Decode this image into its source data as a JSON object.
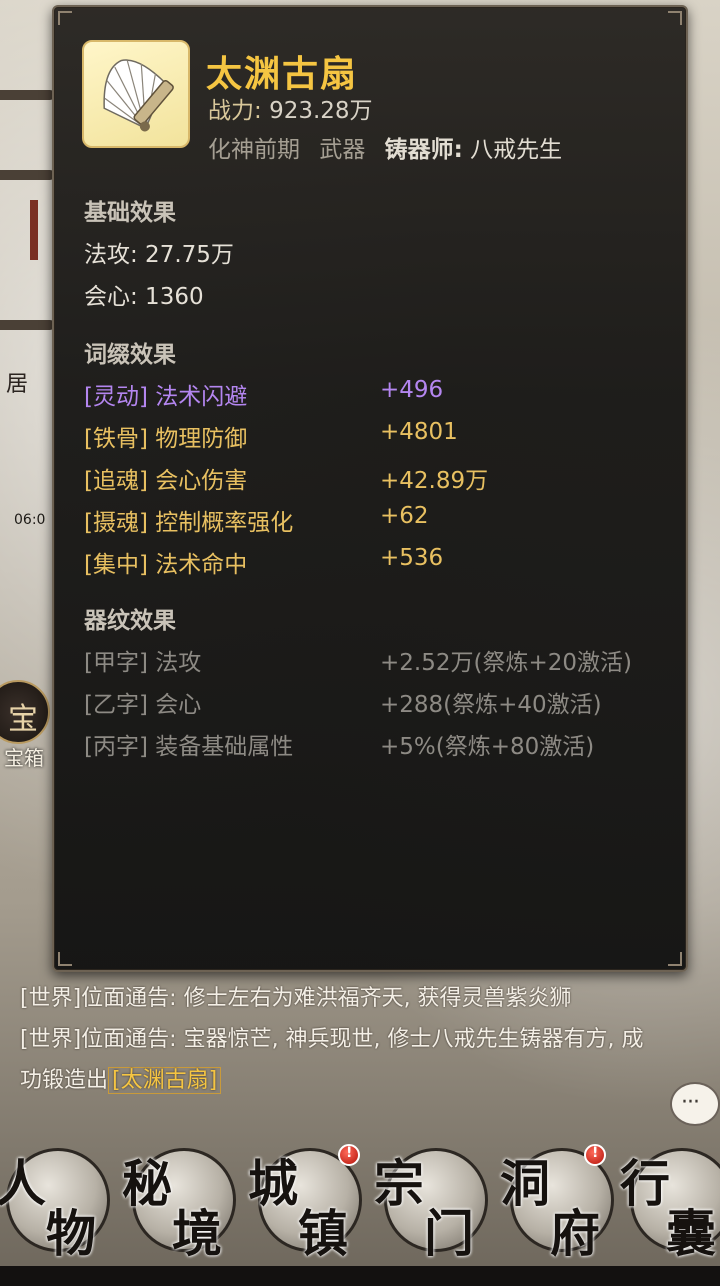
{
  "item": {
    "name": "太渊古扇",
    "power_label": "战力:",
    "power_value": "923.28万",
    "realm": "化神前期",
    "type": "武器",
    "smith_label": "铸器师:",
    "smith_name": "八戒先生"
  },
  "base_effects": {
    "title": "基础效果",
    "lines": [
      "法攻: 27.75万",
      "会心: 1360"
    ]
  },
  "affix_effects": {
    "title": "词缀效果",
    "items": [
      {
        "tag": "[灵动] 法术闪避",
        "value": "+496",
        "color": "#b486f0"
      },
      {
        "tag": "[铁骨] 物理防御",
        "value": "+4801",
        "color": "#e8c061"
      },
      {
        "tag": "[追魂] 会心伤害",
        "value": "+42.89万",
        "color": "#e8c061"
      },
      {
        "tag": "[摄魂] 控制概率强化",
        "value": "+62",
        "color": "#e8c061"
      },
      {
        "tag": "[集中] 法术命中",
        "value": "+536",
        "color": "#e8c061"
      }
    ]
  },
  "pattern_effects": {
    "title": "器纹效果",
    "items": [
      {
        "tag": "[甲字] 法攻",
        "value": "+2.52万(祭炼+20激活)"
      },
      {
        "tag": "[乙字] 会心",
        "value": "+288(祭炼+40激活)"
      },
      {
        "tag": "[丙字] 装备基础属性",
        "value": "+5%(祭炼+80激活)"
      }
    ]
  },
  "chat": {
    "msg1": "[世界]位面通告: 修士左右为难洪福齐天, 获得灵兽紫炎狮",
    "msg2_prefix": "[世界]位面通告: 宝器惊芒, 神兵现世, 修士八戒先生铸器有方, 成功锻造出",
    "msg2_link": "[太渊古扇]",
    "bubble": "···"
  },
  "scene": {
    "time": "06:0",
    "side_char": "居",
    "treasure_char": "宝",
    "treasure_label": "宝箱"
  },
  "nav": [
    {
      "a": "人",
      "b": "物",
      "dot": false
    },
    {
      "a": "秘",
      "b": "境",
      "dot": false
    },
    {
      "a": "城",
      "b": "镇",
      "dot": true
    },
    {
      "a": "宗",
      "b": "门",
      "dot": false
    },
    {
      "a": "洞",
      "b": "府",
      "dot": true
    },
    {
      "a": "行",
      "b": "囊",
      "dot": false
    }
  ],
  "colors": {
    "accent_gold": "#f5c542",
    "affix_purple": "#b486f0",
    "affix_gold": "#e8c061",
    "pattern_grey": "#8d8a84"
  },
  "icons": [
    "fan-icon",
    "chat-bubble-icon",
    "alert-dot-icon"
  ]
}
